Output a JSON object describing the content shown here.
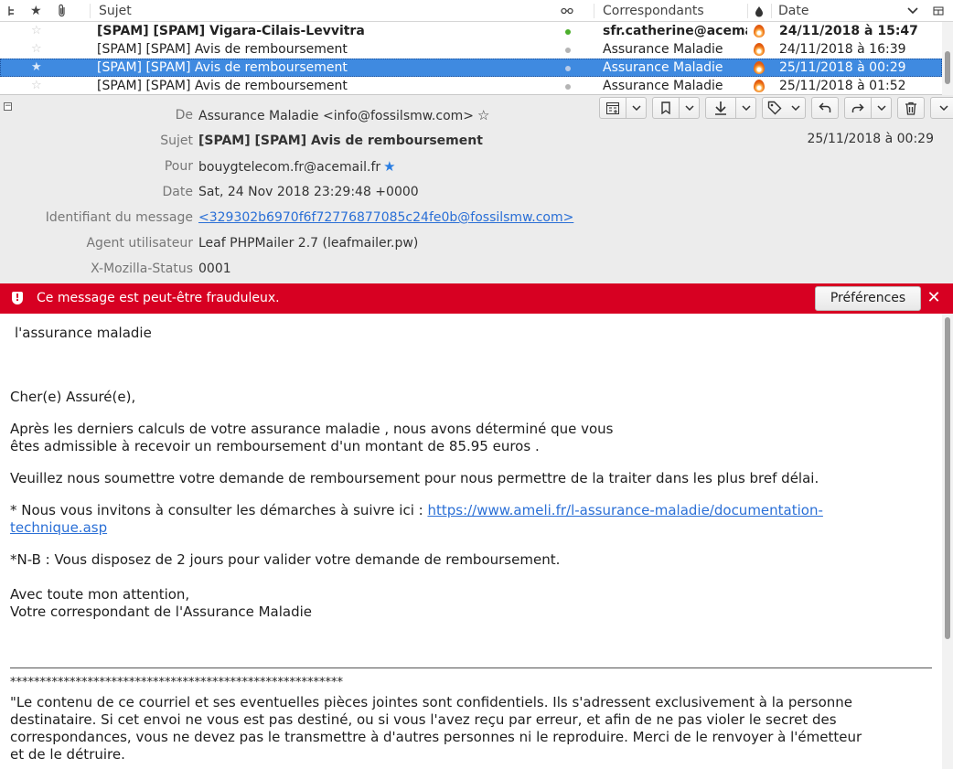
{
  "list": {
    "columns": {
      "subject": "Sujet",
      "correspondents": "Correspondants",
      "date": "Date"
    },
    "rows": [
      {
        "subject": "[SPAM] [SPAM] Vigara-Cilais-Levvitra",
        "from": "sfr.catherine@acema...",
        "date": "24/11/2018 à 15:47",
        "unread": true,
        "selected": false
      },
      {
        "subject": "[SPAM] [SPAM] Avis de remboursement",
        "from": "Assurance Maladie",
        "date": "24/11/2018 à 16:39",
        "unread": false,
        "selected": false
      },
      {
        "subject": "[SPAM] [SPAM] Avis de remboursement",
        "from": "Assurance Maladie",
        "date": "25/11/2018 à 00:29",
        "unread": false,
        "selected": true
      },
      {
        "subject": "[SPAM] [SPAM] Avis de remboursement",
        "from": "Assurance Maladie",
        "date": "25/11/2018 à 01:52",
        "unread": false,
        "selected": false
      }
    ],
    "selected_color": "#3f8ae0"
  },
  "header": {
    "from_label": "De",
    "from_value": "Assurance Maladie <info@fossilsmw.com>",
    "subject_label": "Sujet",
    "subject_value": "[SPAM] [SPAM] Avis de remboursement",
    "date_short": "25/11/2018 à 00:29",
    "to_label": "Pour",
    "to_value": "bouygtelecom.fr@acemail.fr",
    "date_label": "Date",
    "date_value": "Sat, 24 Nov 2018 23:29:48 +0000",
    "msgid_label": "Identifiant du message",
    "msgid_value": "<329302b6970f6f72776877085c24fe0b@fossilsmw.com>",
    "agent_label": "Agent utilisateur",
    "agent_value": "Leaf PHPMailer 2.7 (leafmailer.pw)",
    "status_label": "X-Mozilla-Status",
    "status_value": "0001"
  },
  "notification": {
    "text": "Ce message est peut-être frauduleux.",
    "button": "Préférences",
    "color": "#d70022"
  },
  "body": {
    "greeting_top": "l'assurance maladie",
    "salutation": "Cher(e) Assuré(e),",
    "line1": "Après les derniers calculs de votre assurance maladie , nous avons déterminé que vous",
    "line2": "êtes admissible à recevoir un remboursement d'un montant de 85.95 euros .",
    "line3": "Veuillez nous soumettre votre demande de remboursement pour nous permettre de la traiter dans les plus bref délai.",
    "invite_text": "* Nous vous invitons à consulter les démarches à suivre ici :  ",
    "link_part1": "https://www.ameli.fr/l-assurance-maladie/documentation-",
    "link_part2": "technique.asp",
    "nb": "*N-B : Vous disposez de 2  jours pour valider votre demande de remboursement.",
    "closing1": "Avec toute mon attention,",
    "closing2": "Votre correspondant de l'Assurance Maladie",
    "stars": "********************************************************",
    "disclaimer1": "\"Le contenu de ce courriel et ses eventuelles pièces jointes sont confidentiels. Ils s'adressent exclusivement à la personne",
    "disclaimer2": "destinataire. Si cet envoi ne vous est pas destiné, ou si vous l'avez reçu par erreur, et afin de ne pas violer le secret des",
    "disclaimer3": "correspondances, vous ne devez pas le transmettre à d'autres personnes ni le reproduire. Merci de le renvoyer à l'émetteur",
    "disclaimer4": "et de le détruire."
  }
}
